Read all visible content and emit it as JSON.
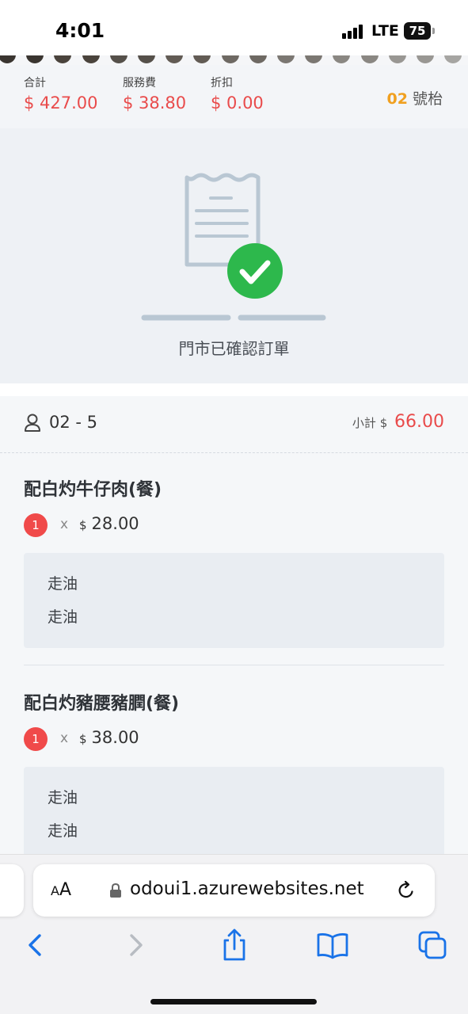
{
  "status_bar": {
    "time": "4:01",
    "network": "LTE",
    "battery": "75"
  },
  "summary": {
    "total_label": "合計",
    "total_value": "$ 427.00",
    "service_label": "服務費",
    "service_value": "$ 38.80",
    "discount_label": "折扣",
    "discount_value": "$ 0.00",
    "table_number": "02",
    "table_suffix": "號枱"
  },
  "confirmation": {
    "message": "門市已確認訂單",
    "icon": "receipt-check-icon"
  },
  "order": {
    "seat": "02 - 5",
    "subtotal_label": "小計",
    "subtotal_currency": "$",
    "subtotal_amount": "66.00",
    "items": [
      {
        "name": "配白灼牛仔肉(餐)",
        "qty": "1",
        "times": "x",
        "currency": "$",
        "price": "28.00",
        "notes": [
          "走油",
          "走油"
        ]
      },
      {
        "name": "配白灼豬腰豬膶(餐)",
        "qty": "1",
        "times": "x",
        "currency": "$",
        "price": "38.00",
        "notes": [
          "走油",
          "走油"
        ]
      }
    ]
  },
  "browser": {
    "text_size_label_small": "A",
    "text_size_label_large": "A",
    "url": "odoui1.azurewebsites.net",
    "icons": [
      "back-icon",
      "forward-icon",
      "share-icon",
      "bookmarks-icon",
      "tabs-icon"
    ]
  },
  "colors": {
    "accent_red": "#e94b4b",
    "table_orange": "#f0a020",
    "check_green": "#2db84c"
  }
}
